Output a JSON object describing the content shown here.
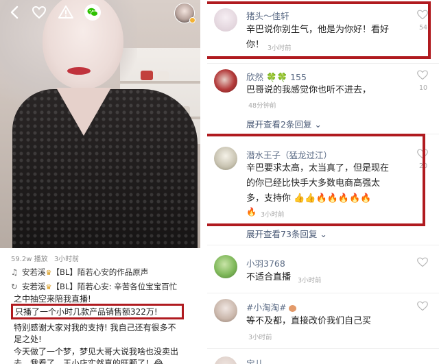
{
  "left": {
    "meta": {
      "plays": "59.2w 播放",
      "time": "3小时前"
    },
    "desc": [
      {
        "icon": "♫",
        "user": "安若溪",
        "badge": "♛",
        "text": "【BL】陌若心安的作品原声"
      },
      {
        "icon": "↻",
        "user": "安若溪",
        "badge": "♛",
        "text": "【BL】陌若心安: 辛苦各位宝宝百忙"
      }
    ],
    "body_lines": [
      "之中抽空来陪我直播!",
      "只播了一个小时几款产品销售额322万!",
      "特别感谢大家对我的支持! 我自己还有很多不",
      "足之处!",
      "今天做了一个梦，梦见大哥大说我啥也没卖出",
      "去，我看了，王小店实然真的旺颗了！😂"
    ]
  },
  "right": {
    "comments": [
      {
        "name": "猪头～佳轩",
        "lines": [
          "辛巴说你别生气，他是为你好！看好",
          "你！"
        ],
        "time": "3小时前",
        "likes": "54",
        "avatar_color": "#e8dfe6"
      },
      {
        "name": "欣然",
        "name_suffix": "🍀🍀 155",
        "lines": [
          "巴哥说的我感觉你也听不进去，"
        ],
        "time": "48分钟前",
        "likes": "10",
        "avatar_color": "#b33a3a"
      },
      {
        "name": "潜水王子（猛龙过江）",
        "lines": [
          "辛巴要求太高，太当真了，但是现在",
          "的你已经比快手大多数电商高强太",
          "多，支持你 👍👍🔥🔥🔥🔥🔥"
        ],
        "time": "3小时前",
        "likes": "20",
        "avatar_color": "#d8d4c4"
      },
      {
        "name": "小羽3768",
        "lines": [
          "不适合直播"
        ],
        "time": "3小时前",
        "likes": "",
        "avatar_color": "#7fb85a"
      },
      {
        "name": "#小淘淘#",
        "lines": [
          "等不及都，直接改价我们自己买"
        ],
        "time": "3小时前",
        "likes": "",
        "avatar_color": "#c9b6aa"
      },
      {
        "name": "宝儿",
        "lines": [],
        "time": "",
        "likes": "",
        "avatar_color": "#d6c7c0"
      }
    ],
    "expand_1": "展开查看2条回复 ⌄",
    "expand_2": "展开查看73条回复 ⌄",
    "lead_emoji": "🔥"
  },
  "colors": {
    "highlight_red": "#b01a1f",
    "name_blue": "#5a6a84",
    "expand_blue": "#4a5a76"
  }
}
